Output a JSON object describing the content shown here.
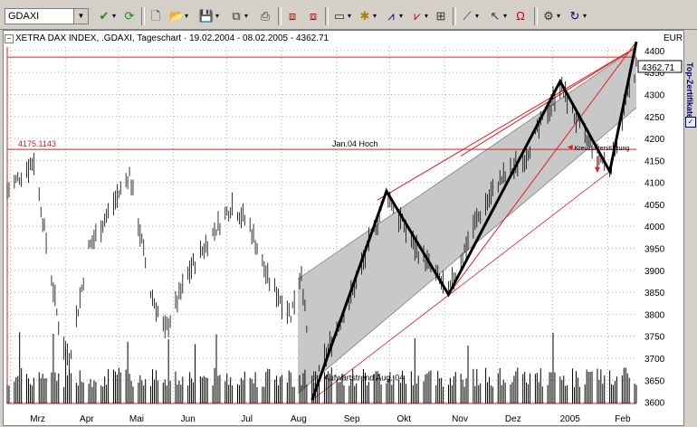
{
  "toolbar": {
    "symbol_value": "GDAXI",
    "icons": [
      "dropdown-arrow-icon",
      "checkmark-icon",
      "refresh-icon",
      "new-document-icon",
      "open-folder-icon",
      "save-icon",
      "copy-icon",
      "print-icon",
      "chart-window-icon",
      "chart-window-2-icon",
      "bar-style-icon",
      "indicator-icon",
      "study-icon",
      "study-2-icon",
      "properties-icon",
      "trendline-icon",
      "cursor-icon",
      "magnet-icon",
      "settings-icon",
      "undo-icon"
    ]
  },
  "chart": {
    "title": "XETRA DAX INDEX, .GDAXI, Tageschart · 19.02.2004 - 08.02.2005 - 4362.71",
    "currency": "EUR",
    "last_price": "4362.71",
    "resistance_label": "4175.1143",
    "annotation_high": "Jan.04 Hoch",
    "annotation_cross": "Kreuzunterstützung",
    "annotation_trend": "Aufwärtstrend Aug. 04"
  },
  "side_panel": {
    "label": "Top-Zertifikate"
  },
  "chart_data": {
    "type": "bar",
    "y_ticks": [
      3600,
      3650,
      3700,
      3750,
      3800,
      3850,
      3900,
      3950,
      4000,
      4050,
      4100,
      4150,
      4200,
      4250,
      4300,
      4350,
      4400
    ],
    "x_ticks": [
      "Mrz",
      "Apr",
      "Mai",
      "Jun",
      "Jul",
      "Aug",
      "Sep",
      "Okt",
      "Nov",
      "Dez",
      "2005",
      "Feb"
    ],
    "ylim": [
      3590,
      4420
    ],
    "resistance_level": 4175.1143,
    "last_value": 4362.71,
    "zigzag": [
      {
        "date": "2004-08-09",
        "value": 3605
      },
      {
        "date": "2004-09-20",
        "value": 4080
      },
      {
        "date": "2004-10-25",
        "value": 3845
      },
      {
        "date": "2004-12-27",
        "value": 4330
      },
      {
        "date": "2005-01-24",
        "value": 4125
      },
      {
        "date": "2005-02-08",
        "value": 4420
      }
    ]
  },
  "colors": {
    "channel_fill": "#c8c8c8",
    "resistance": "#d02020",
    "zigzag": "#000000",
    "bars": "#000000"
  }
}
